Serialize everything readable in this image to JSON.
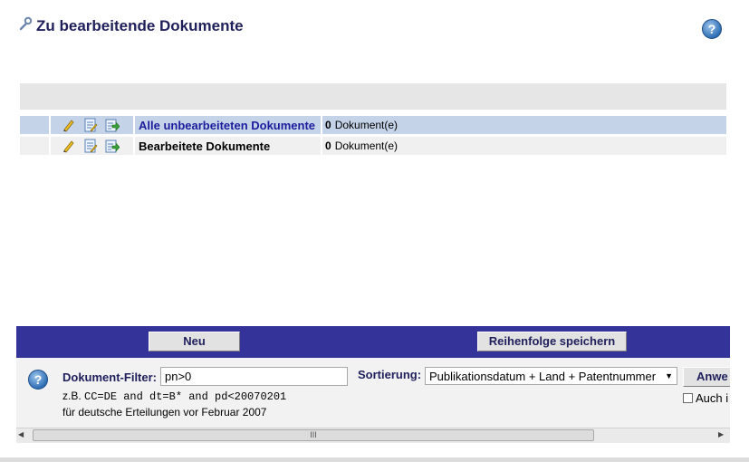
{
  "header": {
    "title": "Zu bearbeitende Dokumente",
    "title_icon": "wrench-icon",
    "help_icon": "help-icon"
  },
  "rows": [
    {
      "name": "Alle unbearbeiteten Dokumente",
      "count": "0",
      "count_label": "Dokument(e)"
    },
    {
      "name": "Bearbeitete Dokumente",
      "count": "0",
      "count_label": "Dokument(e)"
    }
  ],
  "row_icons": [
    "pencil-icon",
    "edit-document-icon",
    "export-icon"
  ],
  "toolbar": {
    "new_label": "Neu",
    "save_order_label": "Reihenfolge speichern"
  },
  "filter": {
    "label": "Dokument-Filter:",
    "value": "pn>0",
    "example_prefix": "z.B.",
    "example_code": "CC=DE and dt=B* and pd<20070201",
    "example_desc": "für deutsche Erteilungen vor Februar 2007"
  },
  "sort": {
    "label": "Sortierung:",
    "selected": "Publikationsdatum + Land + Patentnummer"
  },
  "apply": {
    "label": "Anwe",
    "checkbox_label": "Auch i"
  },
  "scrollbar": {
    "thumb_grip": "III"
  },
  "colors": {
    "title": "#1f1f5c",
    "row_highlight": "#c5d3e8",
    "bar": "#333399"
  }
}
